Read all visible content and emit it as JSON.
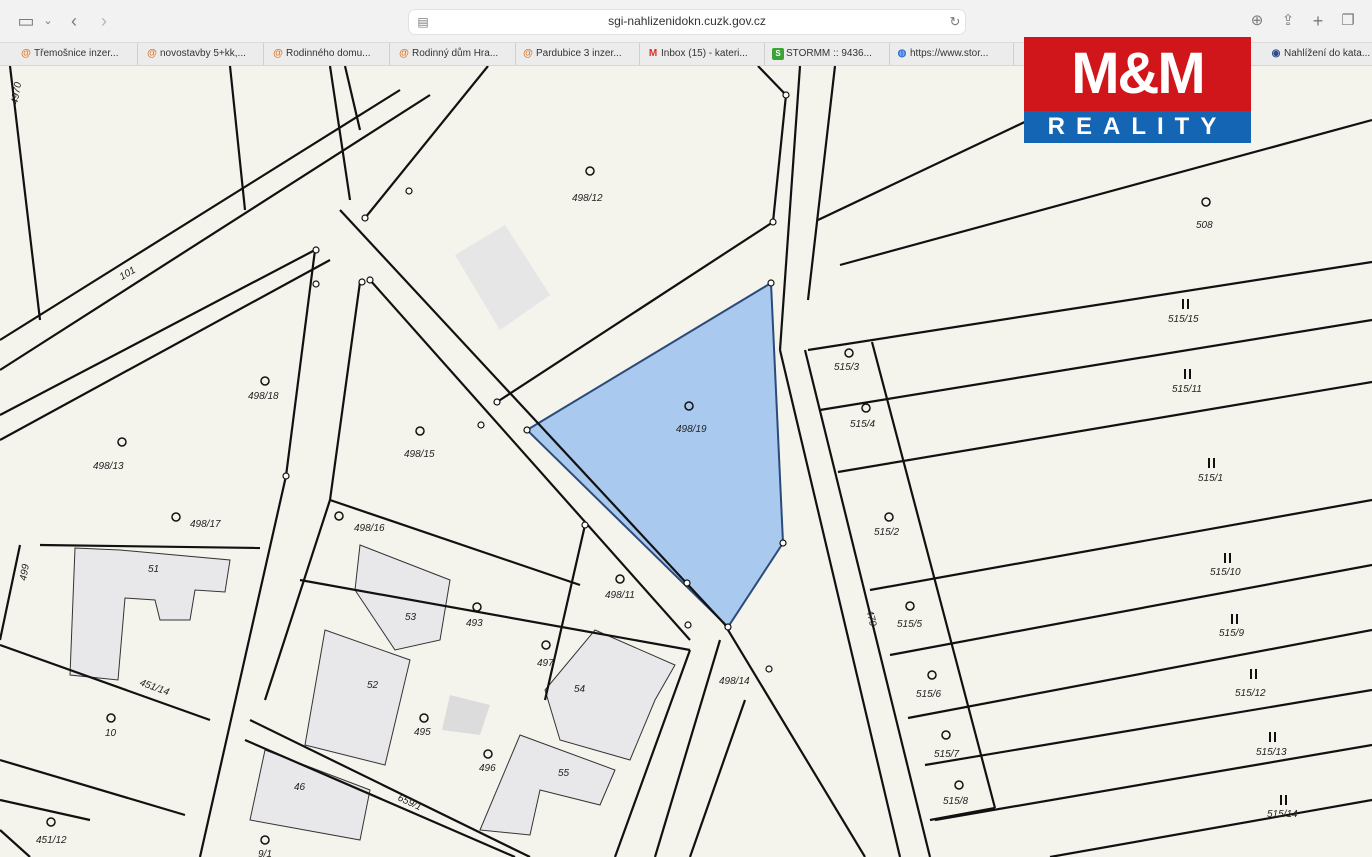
{
  "browser": {
    "url": "sgi-nahlizenidokn.cuzk.gov.cz",
    "bookmarks": [
      {
        "label": "Třemošnice inzer...",
        "icon": "at-icon",
        "color": "#e07a2e"
      },
      {
        "label": "novostavby 5+kk,...",
        "icon": "at-icon",
        "color": "#e07a2e"
      },
      {
        "label": "Rodinného domu...",
        "icon": "at-icon",
        "color": "#e07a2e"
      },
      {
        "label": "Rodinný dům Hra...",
        "icon": "at-icon",
        "color": "#e07a2e"
      },
      {
        "label": "Pardubice 3 inzer...",
        "icon": "at-icon",
        "color": "#e07a2e"
      },
      {
        "label": "Inbox (15) - kateri...",
        "icon": "gmail-icon",
        "color": "#d93025"
      },
      {
        "label": "STORMM :: 9436...",
        "icon": "stormm-icon",
        "color": "#3aa335"
      },
      {
        "label": "https://www.stor...",
        "icon": "globe-icon",
        "color": "#2a6fd6"
      },
      {
        "label": "Nahlížení do kata...",
        "icon": "cuzk-icon",
        "color": "#2c4a8c"
      }
    ]
  },
  "logo": {
    "top": "M&M",
    "bottom": "REALITY"
  },
  "map": {
    "highlight_color": "#a9c9ee",
    "parcels": [
      "498/12",
      "508",
      "515/15",
      "515/3",
      "515/11",
      "515/4",
      "498/19",
      "498/18",
      "498/15",
      "498/13",
      "515/1",
      "515/2",
      "498/17",
      "498/16",
      "51",
      "515/10",
      "498/11",
      "493",
      "53",
      "515/5",
      "515/9",
      "497",
      "479",
      "515/6",
      "515/12",
      "52",
      "54",
      "498/14",
      "451/14",
      "10",
      "495",
      "515/7",
      "515/13",
      "496",
      "55",
      "46",
      "659/1",
      "515/8",
      "515/14",
      "451/12",
      "9/1",
      "101",
      "499",
      "4970"
    ]
  }
}
